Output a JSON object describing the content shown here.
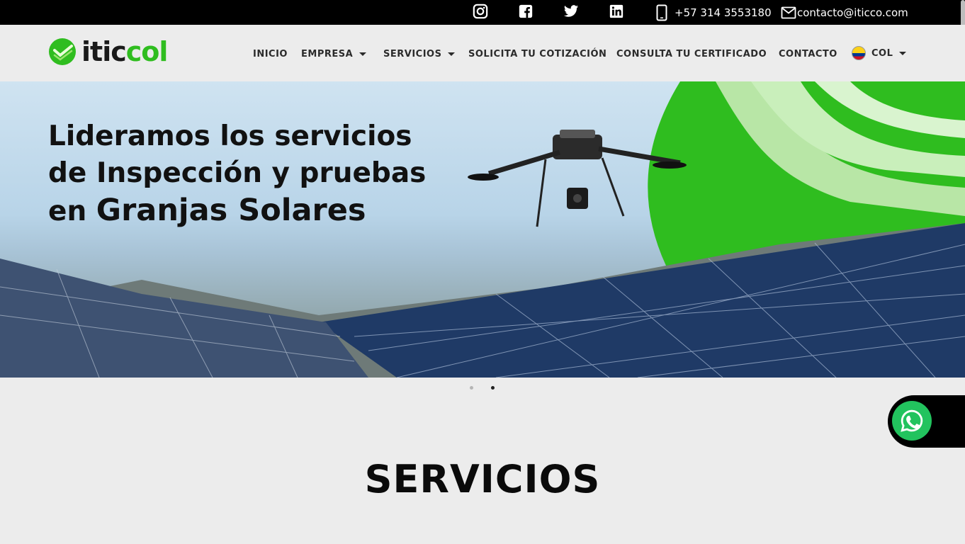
{
  "topbar": {
    "social": [
      "instagram-icon",
      "facebook-icon",
      "twitter-icon",
      "linkedin-icon"
    ],
    "phone": "+57 314 3553180",
    "email": "contacto@iticco.com"
  },
  "header": {
    "logo_part1": "itic",
    "logo_part2": "col",
    "nav": {
      "inicio": "INICIO",
      "empresa": "EMPRESA",
      "servicios": "SERVICIOS",
      "cotizacion": "SOLICITA TU COTIZACIÓN",
      "certificado": "CONSULTA TU CERTIFICADO",
      "contacto": "CONTACTO",
      "country": "COL"
    }
  },
  "hero": {
    "line1": "Lideramos los servicios",
    "line2": "de Inspección y pruebas",
    "line3_a": "en ",
    "line3_b": "Granjas Solares"
  },
  "carousel": {
    "slides": 2,
    "active": 2
  },
  "section": {
    "title": "SERVICIOS"
  },
  "colors": {
    "brand_green": "#2fbd1f",
    "whatsapp": "#22c35e"
  }
}
